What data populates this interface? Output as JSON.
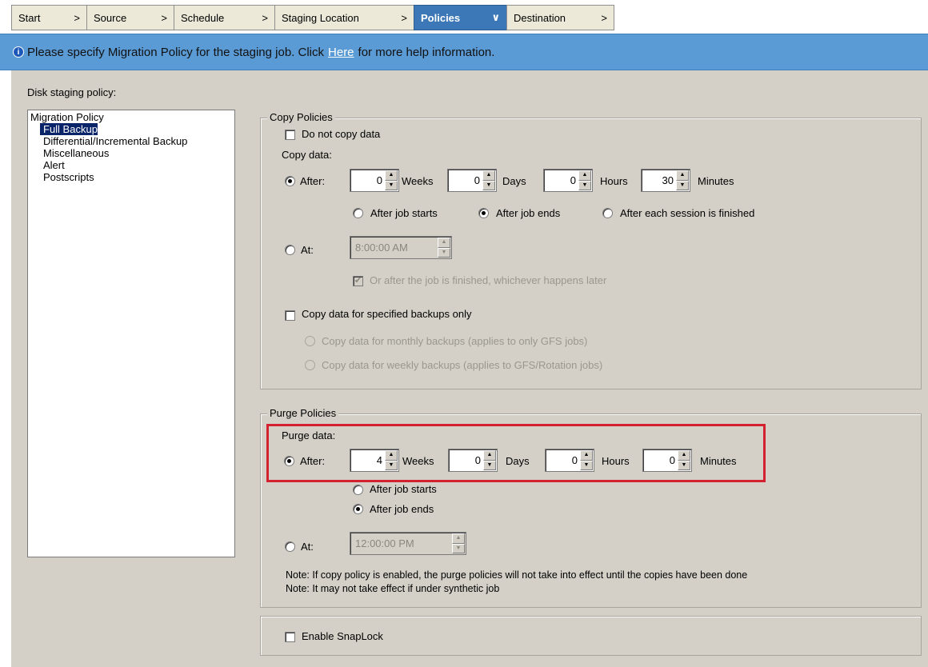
{
  "tabs": [
    {
      "label": "Start",
      "arrow": ">"
    },
    {
      "label": "Source",
      "arrow": ">"
    },
    {
      "label": "Schedule",
      "arrow": ">"
    },
    {
      "label": "Staging Location",
      "arrow": ">"
    },
    {
      "label": "Policies",
      "arrow": "∨"
    },
    {
      "label": "Destination",
      "arrow": ">"
    }
  ],
  "banner": {
    "text_before": "Please specify Migration Policy for the staging job. Click",
    "link": "Here",
    "text_after": "for more help information."
  },
  "disk_staging_label": "Disk staging policy:",
  "tree": {
    "root": "Migration Policy",
    "items": [
      "Full Backup",
      "Differential/Incremental Backup",
      "Miscellaneous",
      "Alert",
      "Postscripts"
    ],
    "selected": "Full Backup"
  },
  "copy_policies": {
    "legend": "Copy Policies",
    "do_not_copy": "Do not copy data",
    "copy_data_label": "Copy data:",
    "after_label": "After:",
    "weeks": {
      "value": "0",
      "unit": "Weeks"
    },
    "days": {
      "value": "0",
      "unit": "Days"
    },
    "hours": {
      "value": "0",
      "unit": "Hours"
    },
    "minutes": {
      "value": "30",
      "unit": "Minutes"
    },
    "after_job_starts": "After job starts",
    "after_job_ends": "After job ends",
    "after_each_session": "After each session is finished",
    "at_label": "At:",
    "at_time": "8:00:00 AM",
    "or_after_job": "Or after the job is finished, whichever happens later",
    "specified_only": "Copy data for specified backups only",
    "monthly": "Copy data for monthly backups (applies to only GFS jobs)",
    "weekly": "Copy data for weekly backups (applies to GFS/Rotation jobs)"
  },
  "purge_policies": {
    "legend": "Purge Policies",
    "purge_data_label": "Purge data:",
    "after_label": "After:",
    "weeks": {
      "value": "4",
      "unit": "Weeks"
    },
    "days": {
      "value": "0",
      "unit": "Days"
    },
    "hours": {
      "value": "0",
      "unit": "Hours"
    },
    "minutes": {
      "value": "0",
      "unit": "Minutes"
    },
    "after_job_starts": "After job starts",
    "after_job_ends": "After job ends",
    "at_label": "At:",
    "at_time": "12:00:00 PM",
    "note1": "Note: If copy policy is enabled, the purge policies will not take into effect until the copies have been done",
    "note2": "Note: It may not take effect if under synthetic job"
  },
  "snaplock": {
    "label": "Enable SnapLock"
  },
  "colors": {
    "banner": "#5b9bd5",
    "active_tab": "#3c78b8",
    "highlight": "#d4212f",
    "panel": "#d4d0c8"
  }
}
